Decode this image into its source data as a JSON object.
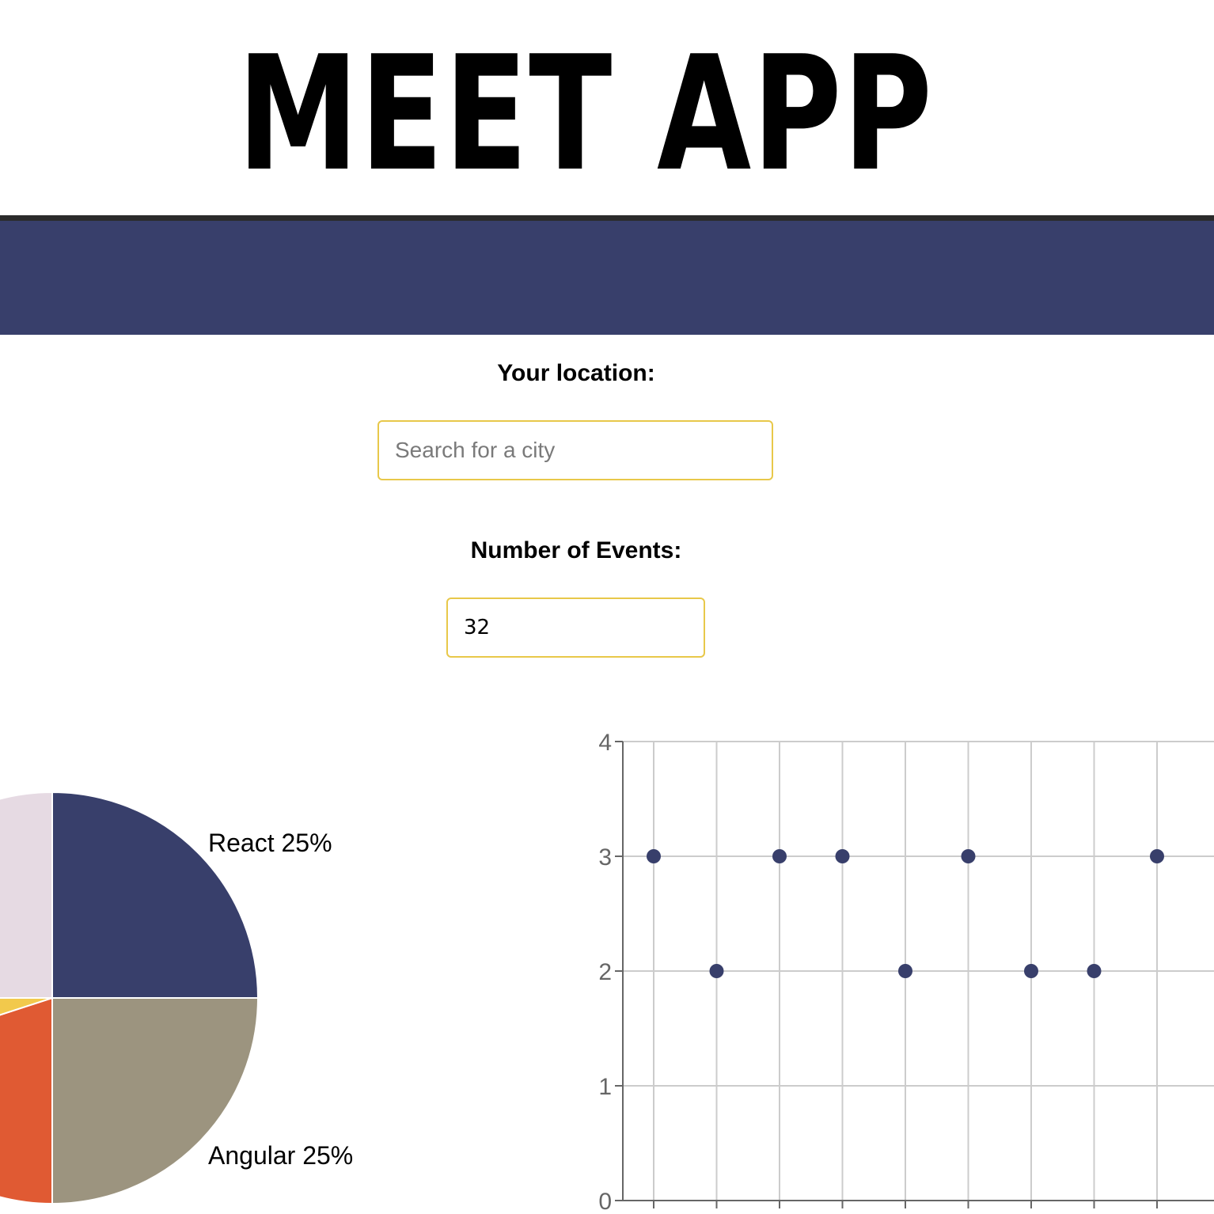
{
  "app": {
    "title": "MEET APP"
  },
  "colors": {
    "navy": "#383f6b",
    "input_border": "#e8c84a",
    "header_rule": "#2b2b2b"
  },
  "city_search": {
    "label": "Your location:",
    "placeholder": "Search for a city",
    "value": ""
  },
  "number_of_events": {
    "label": "Number of Events:",
    "value": "32"
  },
  "chart_data": [
    {
      "type": "pie",
      "slices": [
        {
          "name": "React",
          "percent": 25,
          "color": "#383f6b"
        },
        {
          "name": "Angular",
          "percent": 25,
          "color": "#9c947f"
        },
        {
          "name": "",
          "percent": 20,
          "color": "#e05a33"
        },
        {
          "name": "",
          "percent": 5,
          "color": "#f2c94c"
        },
        {
          "name": "",
          "percent": 25,
          "color": "#e6dae3"
        }
      ],
      "labels": [
        {
          "text": "React 25%",
          "slice": 0
        },
        {
          "text": "Angular 25%",
          "slice": 1
        }
      ]
    },
    {
      "type": "scatter",
      "y_ticks": [
        "0",
        "1",
        "2",
        "3",
        "4"
      ],
      "ylim": [
        0,
        4
      ],
      "grid": true,
      "point_color": "#383f6b",
      "values": [
        3,
        2,
        3,
        3,
        2,
        3,
        2,
        2,
        3
      ]
    }
  ]
}
